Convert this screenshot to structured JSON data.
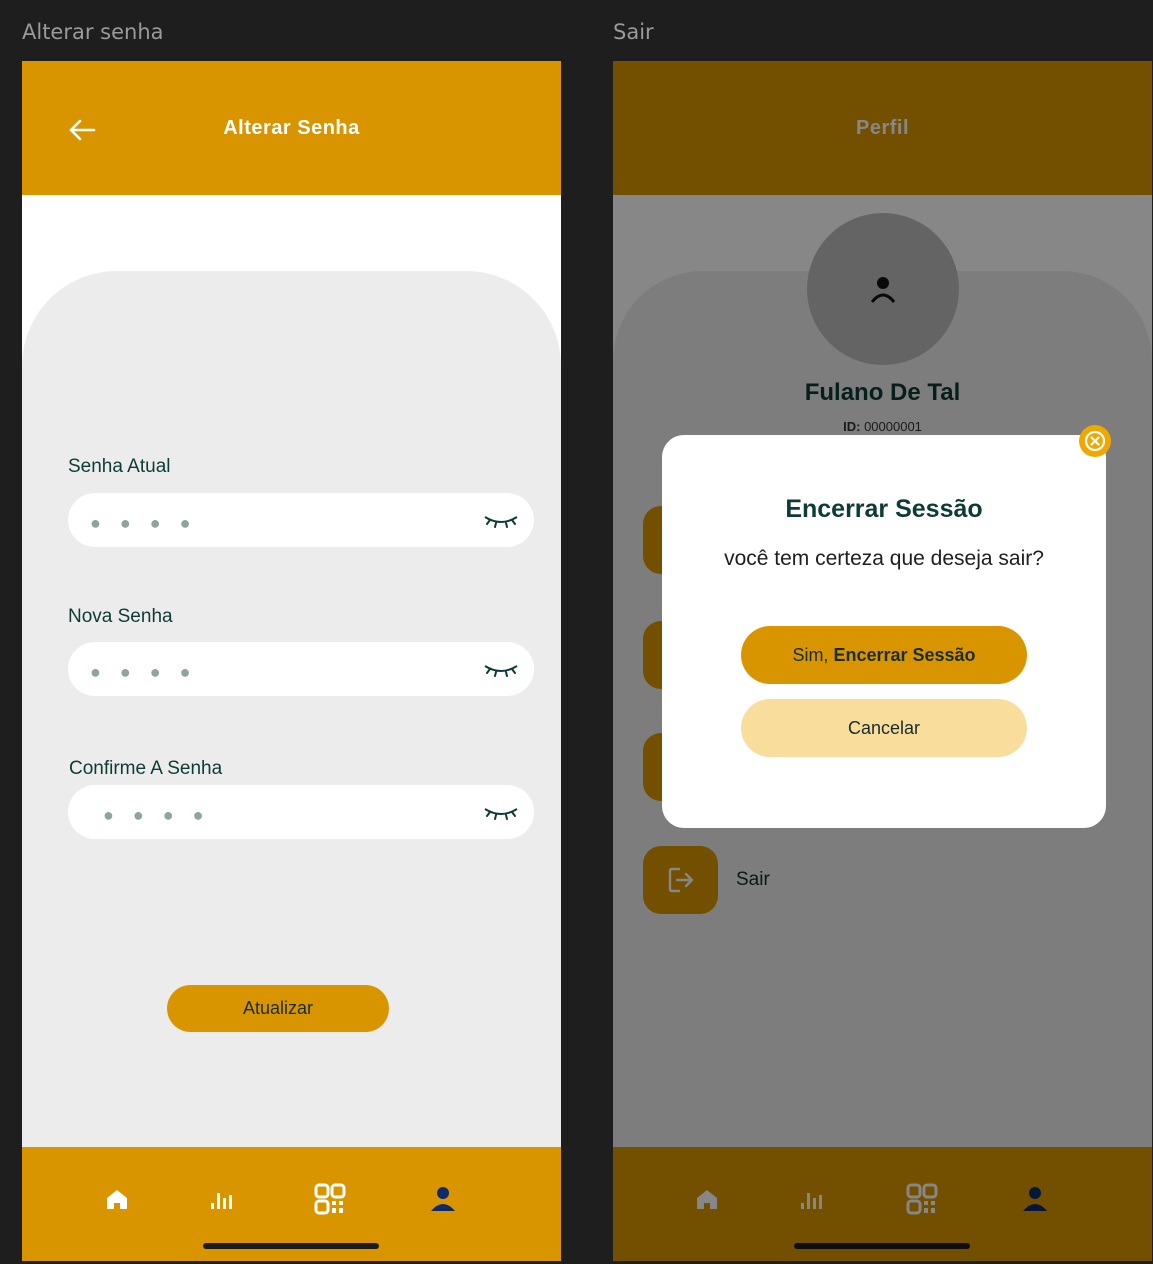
{
  "frames": {
    "left_title": "Alterar senha",
    "right_title": "Sair"
  },
  "change_password": {
    "header_title": "Alterar Senha",
    "fields": [
      {
        "label": "Senha Atual",
        "value": "● ● ● ●"
      },
      {
        "label": "Nova Senha",
        "value": "● ● ● ●"
      },
      {
        "label": "Confirme A Senha",
        "value": "● ● ● ●"
      }
    ],
    "submit_label": "Atualizar"
  },
  "profile": {
    "header_title": "Perfil",
    "name": "Fulano De Tal",
    "id_label": "ID:",
    "id_value": "00000001",
    "menu_last_label": "Sair"
  },
  "modal": {
    "title": "Encerrar Sessão",
    "message": "você tem certeza que deseja sair?",
    "confirm_prefix": "Sim, ",
    "confirm_bold": "Encerrar Sessão",
    "cancel_label": "Cancelar"
  },
  "nav": {
    "items": [
      "home-icon",
      "chart-icon",
      "qr-code-icon",
      "profile-icon"
    ],
    "active_color": "#0d2a6b",
    "color": "#ffffff"
  },
  "colors": {
    "primary": "#d99500",
    "secondary": "#f8dd9d",
    "text_dark": "#0e3b35"
  }
}
